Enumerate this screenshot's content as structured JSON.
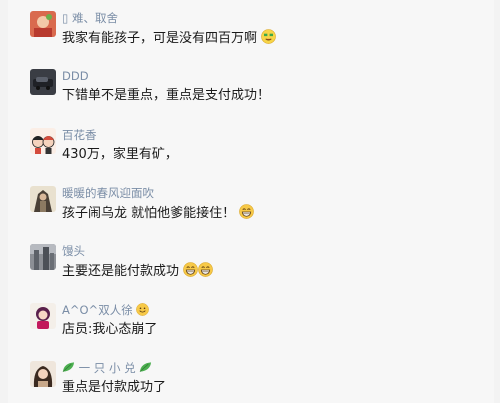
{
  "comments": [
    {
      "name": "▯ 难、取舍",
      "text": "我家有能孩子，可是没有四百万啊"
    },
    {
      "name": "DDD",
      "text": "下错单不是重点，重点是支付成功！"
    },
    {
      "name": "百花香",
      "text": "430万，家里有矿，"
    },
    {
      "name": "暖暖的春风迎面吹",
      "text": "孩子闹乌龙 就怕他爹能接住！"
    },
    {
      "name": "馒头",
      "text": "主要还是能付款成功"
    },
    {
      "name": "A^O^双人徐",
      "text": "店员:我心态崩了"
    },
    {
      "name": "一 只 小 兑",
      "text": "重点是付款成功了"
    }
  ],
  "icons": {
    "money_face": "money-face-emoji",
    "grin": "grin-emoji",
    "smile": "smile-emoji",
    "leaf": "leaf-emoji"
  }
}
